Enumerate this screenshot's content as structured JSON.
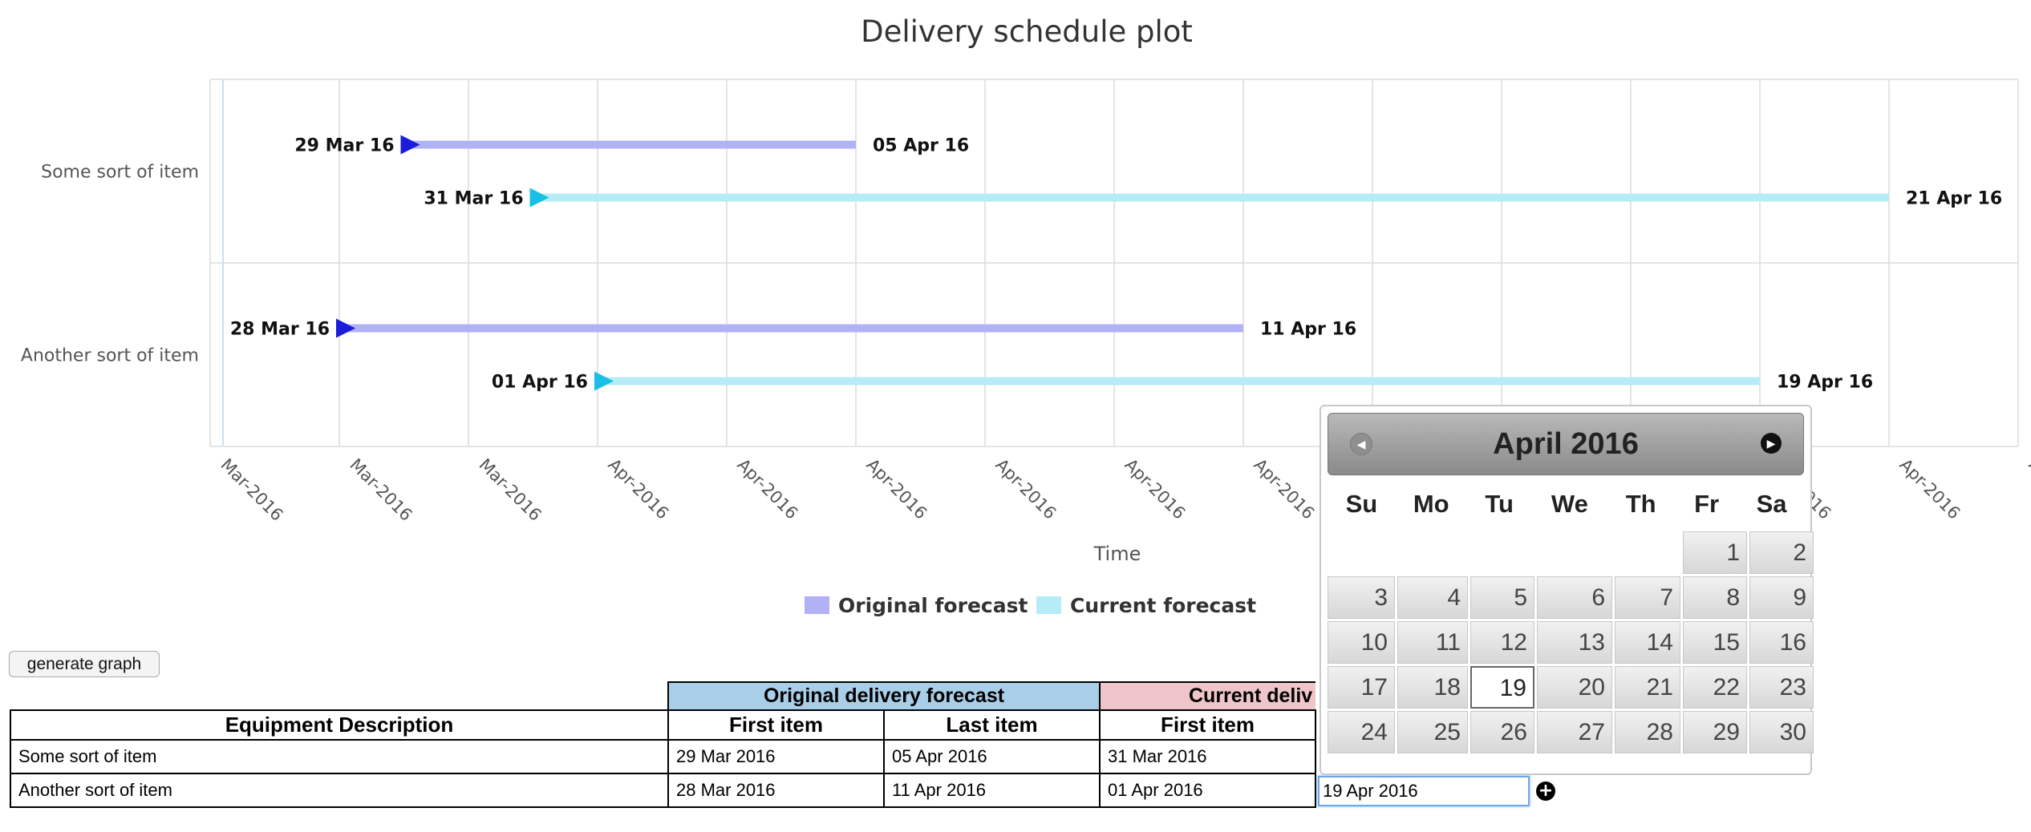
{
  "chart_data": {
    "type": "gantt",
    "title": "Delivery schedule plot",
    "categories": [
      "Some sort of item",
      "Another sort of item"
    ],
    "series": [
      {
        "name": "Original forecast",
        "color": "#b1b1f6",
        "marker_color": "#1c1cdb",
        "ranges": [
          {
            "start": "2016-03-29",
            "end": "2016-04-05",
            "start_label": "29 Mar 16",
            "end_label": "05 Apr 16"
          },
          {
            "start": "2016-03-28",
            "end": "2016-04-11",
            "start_label": "28 Mar 16",
            "end_label": "11 Apr 16"
          }
        ]
      },
      {
        "name": "Current forecast",
        "color": "#b6ecf7",
        "marker_color": "#19bfe6",
        "ranges": [
          {
            "start": "2016-03-31",
            "end": "2016-04-21",
            "start_label": "31 Mar 16",
            "end_label": "21 Apr 16"
          },
          {
            "start": "2016-04-01",
            "end": "2016-04-19",
            "start_label": "01 Apr 16",
            "end_label": "19 Apr 16"
          }
        ]
      }
    ],
    "xlabel": "Time",
    "xlim": [
      "2016-03-26",
      "2016-04-23"
    ],
    "x_ticks": [
      "Mar-2016",
      "Mar-2016",
      "Mar-2016",
      "Apr-2016",
      "Apr-2016",
      "Apr-2016",
      "Apr-2016",
      "Apr-2016",
      "Apr-2016",
      "Apr-2016",
      "Apr-2016",
      "Apr-2016",
      "Apr-2016",
      "Apr-2016",
      "Apr-2016"
    ],
    "grid": true,
    "legend": "bottom-center"
  },
  "controls": {
    "generate_label": "generate graph"
  },
  "table": {
    "group_headers": {
      "original": "Original delivery forecast",
      "current": "Current deliv"
    },
    "columns": {
      "description": "Equipment Description",
      "orig_first": "First item",
      "orig_last": "Last item",
      "curr_first": "First item"
    },
    "rows": [
      {
        "description": "Some sort of item",
        "orig_first": "29 Mar 2016",
        "orig_last": "05 Apr 2016",
        "curr_first": "31 Mar 2016"
      },
      {
        "description": "Another sort of item",
        "orig_first": "28 Mar 2016",
        "orig_last": "11 Apr 2016",
        "curr_first": "01 Apr 2016"
      }
    ],
    "editing_value": "19 Apr 2016"
  },
  "datepicker": {
    "title": "April 2016",
    "weekdays": [
      "Su",
      "Mo",
      "Tu",
      "We",
      "Th",
      "Fr",
      "Sa"
    ],
    "leading_blanks": 5,
    "days": [
      1,
      2,
      3,
      4,
      5,
      6,
      7,
      8,
      9,
      10,
      11,
      12,
      13,
      14,
      15,
      16,
      17,
      18,
      19,
      20,
      21,
      22,
      23,
      24,
      25,
      26,
      27,
      28,
      29,
      30
    ],
    "selected": 19,
    "prev_icon": "chevron-left-icon",
    "next_icon": "chevron-right-icon"
  },
  "icons": {
    "add": "+"
  }
}
